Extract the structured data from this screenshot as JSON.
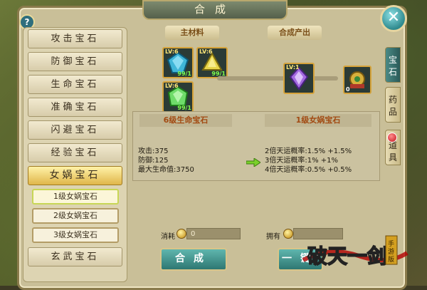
{
  "window": {
    "title": "合成",
    "help_icon": "?",
    "close_icon": "✕"
  },
  "categories": [
    {
      "label": "攻击宝石"
    },
    {
      "label": "防御宝石"
    },
    {
      "label": "生命宝石"
    },
    {
      "label": "准确宝石"
    },
    {
      "label": "闪避宝石"
    },
    {
      "label": "经验宝石"
    },
    {
      "label": "女娲宝石",
      "selected": true
    }
  ],
  "subitems": [
    {
      "label": "1级女娲宝石",
      "selected": true
    },
    {
      "label": "2级女娲宝石"
    },
    {
      "label": "3级女娲宝石"
    }
  ],
  "last_category": {
    "label": "玄武宝石"
  },
  "headers": {
    "materials": "主材料",
    "output": "合成产出"
  },
  "materials": [
    {
      "level": "LV:6",
      "count": "99/1",
      "gem": "blue"
    },
    {
      "level": "LV:6",
      "count": "99/1",
      "gem": "yellow"
    },
    {
      "level": "LV:6",
      "count": "99/1",
      "gem": "green"
    }
  ],
  "output_item": {
    "level": "LV:1",
    "gem": "purple"
  },
  "extra_item": {
    "count": "0"
  },
  "info": {
    "left_title": "6级生命宝石",
    "left_stats": [
      "攻击:375",
      "防御:125",
      "最大生命值:3750"
    ],
    "right_title": "1级女娲宝石",
    "right_stats": [
      "2倍天运概率:1.5% +1.5%",
      "3倍天运概率:1% +1%",
      "4倍天运概率:0.5% +0.5%"
    ]
  },
  "cost": {
    "label": "消耗",
    "value": "0"
  },
  "own": {
    "label": "拥有"
  },
  "buttons": {
    "compose": "合成",
    "one_click": "一键"
  },
  "tabs": [
    {
      "label": "宝石",
      "selected": true
    },
    {
      "label": "药品"
    },
    {
      "label": "道具"
    }
  ],
  "logo": {
    "text": "破天一剑",
    "badge": "手游版"
  },
  "colors": {
    "accent_teal": "#2e7772",
    "header_red": "#a24a12",
    "gold_border": "#d5a33a"
  }
}
